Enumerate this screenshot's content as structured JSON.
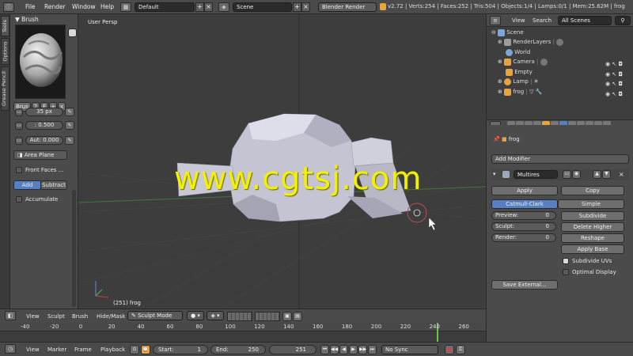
{
  "topbar": {
    "menus": [
      "File",
      "Render",
      "Window",
      "Help"
    ],
    "layout": "Default",
    "scene": "Scene",
    "engine": "Blender Render",
    "info": "v2.72 | Verts:254 | Faces:252 | Tris:504 | Objects:1/4 | Lamps:0/1 | Mem:25.62M | frog"
  },
  "left_tabs": [
    "Tools",
    "Options",
    "Grease Pencil"
  ],
  "tools": {
    "brush_header": "Brush",
    "brush_name": "Brus",
    "brush_users": "2",
    "brush_fake": "F",
    "radius": "35 px",
    "strength": ": 0.500",
    "autosmooth": "Aut: 0.000",
    "plane": "Area Plane",
    "front_faces": "Front Faces ...",
    "add": "Add",
    "subtract": "Subtract",
    "accumulate": "Accumulate"
  },
  "viewport": {
    "view_label": "User Persp",
    "object_label": "(251) frog",
    "watermark": "www.cgtsj.com"
  },
  "outliner": {
    "view": "View",
    "search": "Search",
    "filter": "All Scenes",
    "items": [
      {
        "name": "Scene",
        "color": "#7aa7d8"
      },
      {
        "name": "RenderLayers",
        "color": "#9c9c9c"
      },
      {
        "name": "World",
        "color": "#7aa7d8"
      },
      {
        "name": "Camera",
        "color": "#e8a33c"
      },
      {
        "name": "Empty",
        "color": "#e8a33c"
      },
      {
        "name": "Lamp",
        "color": "#e8a33c"
      },
      {
        "name": "frog",
        "color": "#e8a33c"
      }
    ]
  },
  "properties": {
    "object_name": "frog",
    "add_modifier": "Add Modifier",
    "modifier_name": "Multires",
    "apply": "Apply",
    "copy": "Copy",
    "catmull": "Catmull-Clark",
    "simple": "Simple",
    "preview_label": "Preview:",
    "preview_value": "0",
    "sculpt_label": "Sculpt:",
    "sculpt_value": "0",
    "render_label": "Render:",
    "render_value": "0",
    "subdivide": "Subdivide",
    "delete_higher": "Delete Higher",
    "reshape": "Reshape",
    "apply_base": "Apply Base",
    "subdivide_uvs": "Subdivide UVs",
    "optimal_display": "Optimal Display",
    "save_external": "Save External..."
  },
  "bottombar": {
    "menus": [
      "View",
      "Sculpt",
      "Brush",
      "Hide/Mask"
    ],
    "mode": "Sculpt Mode"
  },
  "timeline": {
    "ticks": [
      "-40",
      "-20",
      "0",
      "20",
      "40",
      "60",
      "80",
      "100",
      "120",
      "140",
      "160",
      "180",
      "200",
      "220",
      "240",
      "260"
    ],
    "current_frame": 251
  },
  "timeline_header": {
    "menus": [
      "View",
      "Marker",
      "Frame",
      "Playback"
    ],
    "start": "Start:",
    "start_value": "1",
    "end": "End:",
    "end_value": "250",
    "current": "251",
    "sync": "No Sync"
  }
}
